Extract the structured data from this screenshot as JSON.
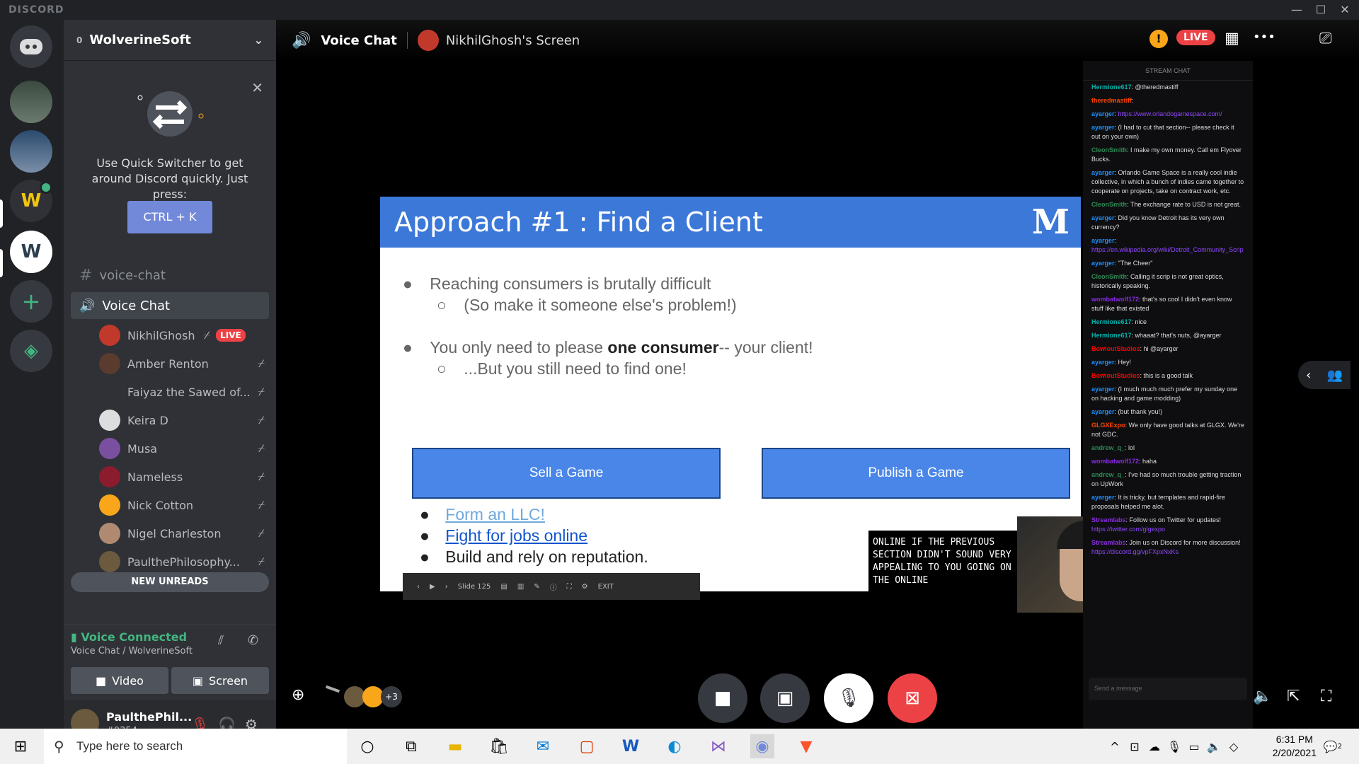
{
  "window": {
    "brand": "DISCORD",
    "minimize": "—",
    "maximize": "☐",
    "close": "✕"
  },
  "server": {
    "name": "WolverineSoft",
    "boost_level": "0"
  },
  "quick_switcher": {
    "text": "Use Quick Switcher to get around Discord quickly. Just press:",
    "shortcut": "CTRL + K"
  },
  "channels": [
    {
      "name": "voice-chat",
      "type": "text"
    },
    {
      "name": "Voice Chat",
      "type": "voice"
    }
  ],
  "voice_users": [
    {
      "name": "NikhilGhosh",
      "live": "LIVE",
      "avatar_color": "#c0392b"
    },
    {
      "name": "Amber Renton",
      "avatar_color": "#5a3b2e"
    },
    {
      "name": "Faiyaz the Sawed of...",
      "avatar_color": "#2f3136"
    },
    {
      "name": "Keira D",
      "avatar_color": "#dcddde"
    },
    {
      "name": "Musa",
      "avatar_color": "#7b4fa0"
    },
    {
      "name": "Nameless",
      "avatar_color": "#8a1c2e"
    },
    {
      "name": "Nick Cotton",
      "avatar_color": "#faa61a"
    },
    {
      "name": "Nigel Charleston",
      "avatar_color": "#b08a70"
    },
    {
      "name": "PaulthePhilosophy...",
      "avatar_color": "#6b5a3e"
    }
  ],
  "new_unreads": "NEW UNREADS",
  "voice_connection": {
    "status": "Voice Connected",
    "location": "Voice Chat / WolverineSoft",
    "video_label": "Video",
    "screen_label": "Screen"
  },
  "user": {
    "name": "PaulthePhil...",
    "tag": "#0354"
  },
  "stage": {
    "channel": "Voice Chat",
    "screen_title": "NikhilGhosh's Screen",
    "live": "LIVE",
    "warning": "!",
    "more": "•••",
    "participants_extra": "+3"
  },
  "slide": {
    "title": "Approach #1 : Find a Client",
    "logo": "M",
    "bullets": [
      {
        "text": "Reaching consumers is brutally difficult",
        "sub": "(So make it someone else's problem!)"
      },
      {
        "pre": "You only need to please ",
        "bold": "one consumer",
        "post": "-- your client!",
        "sub": "...But you still need to find one!"
      }
    ],
    "button_left": "Sell a Game",
    "button_right": "Publish a Game",
    "list": [
      "Form an LLC!",
      "Fight for jobs online",
      "Build and rely on reputation."
    ],
    "controls": {
      "slide": "Slide 125",
      "exit": "EXIT"
    },
    "caption": "ONLINE IF THE PREVIOUS SECTION DIDN'T SOUND VERY APPEALING TO YOU GOING ON THE ONLINE"
  },
  "stream_chat": {
    "header": "STREAM CHAT",
    "messages": [
      {
        "user": "Hermione617",
        "color": "#00b5ad",
        "text": "@theredmastiff"
      },
      {
        "user": "theredmastiff",
        "color": "#ff4500",
        "text": ""
      },
      {
        "user": "ayarger",
        "color": "#1e90ff",
        "text": "",
        "link": "https://www.orlandogamespace.com/"
      },
      {
        "user": "ayarger",
        "color": "#1e90ff",
        "text": "(I had to cut that section-- please check it out on your own)"
      },
      {
        "user": "CleonSmith",
        "color": "#2e8b57",
        "text": "I make my own money. Call em Flyover Bucks."
      },
      {
        "user": "ayarger",
        "color": "#1e90ff",
        "text": "Orlando Game Space is a really cool indie collective, in which a bunch of indies came together to cooperate on projects, take on contract work, etc."
      },
      {
        "user": "CleonSmith",
        "color": "#2e8b57",
        "text": "The exchange rate to USD is not great."
      },
      {
        "user": "ayarger",
        "color": "#1e90ff",
        "text": "Did you know Detroit has its very own currency?"
      },
      {
        "user": "ayarger",
        "color": "#1e90ff",
        "text": "",
        "link": "https://en.wikipedia.org/wiki/Detroit_Community_Scrip"
      },
      {
        "user": "ayarger",
        "color": "#1e90ff",
        "text": "\"The Cheer\""
      },
      {
        "user": "CleonSmith",
        "color": "#2e8b57",
        "text": "Calling it scrip is not great optics, historically speaking."
      },
      {
        "user": "wombatwolf172",
        "color": "#8a2be2",
        "text": "that's so cool I didn't even know stuff like that existed"
      },
      {
        "user": "Hermione617",
        "color": "#00b5ad",
        "text": "nice"
      },
      {
        "user": "Hermione617",
        "color": "#00b5ad",
        "text": "whaaat? that's nuts, @ayarger"
      },
      {
        "user": "BowloutStudios",
        "color": "#ff0000",
        "text": "hi @ayarger"
      },
      {
        "user": "ayarger",
        "color": "#1e90ff",
        "text": "Hey!"
      },
      {
        "user": "BowloutStudios",
        "color": "#ff0000",
        "text": "this is a good talk"
      },
      {
        "user": "ayarger",
        "color": "#1e90ff",
        "text": "(I much much much prefer my sunday one on hacking and game modding)"
      },
      {
        "user": "ayarger",
        "color": "#1e90ff",
        "text": "(but thank you!)"
      },
      {
        "user": "GLGXExpo",
        "color": "#ff4500",
        "text": "We only have good talks at GLGX. We're not GDC."
      },
      {
        "user": "andrew_q_",
        "color": "#2e8b57",
        "text": "lol"
      },
      {
        "user": "wombatwolf172",
        "color": "#8a2be2",
        "text": "haha"
      },
      {
        "user": "andrew_q_",
        "color": "#2e8b57",
        "text": "I've had so much trouble getting traction on UpWork"
      },
      {
        "user": "ayarger",
        "color": "#1e90ff",
        "text": "It is tricky, but templates and rapid-fire proposals helped me alot."
      },
      {
        "user": "Streamlabs",
        "color": "#8a2be2",
        "text": "Follow us on Twitter for updates!",
        "link": "https://twitter.com/glgexpo"
      },
      {
        "user": "Streamlabs",
        "color": "#8a2be2",
        "text": "Join us on Discord for more discussion!",
        "link": "https://discord.gg/vpFXpxNxKs"
      }
    ],
    "input_placeholder": "Send a message"
  },
  "taskbar": {
    "search_placeholder": "Type here to search",
    "time": "6:31 PM",
    "date": "2/20/2021",
    "notifications": "2"
  },
  "colors": {
    "blurple": "#7289da",
    "green": "#43b581",
    "red": "#ed4245",
    "slide_blue": "#3c78d8"
  }
}
